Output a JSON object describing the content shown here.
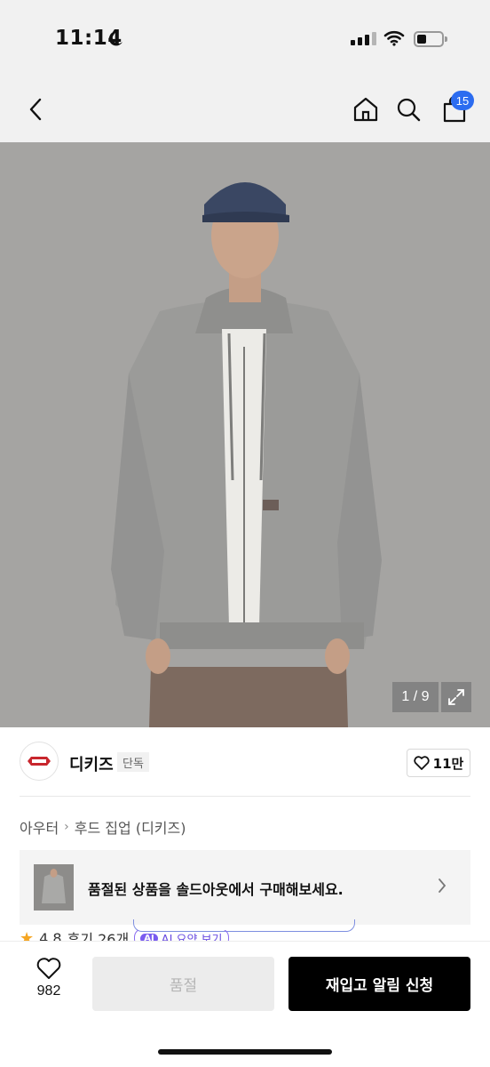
{
  "status_bar": {
    "time": "11:14"
  },
  "nav": {
    "cart_count": "15"
  },
  "product_image": {
    "counter": "1 / 9"
  },
  "brand": {
    "name": "디키즈",
    "badge": "단독",
    "likes": "11만"
  },
  "breadcrumb": {
    "category": "아우터",
    "subcategory": "후드 집업 (디키즈)"
  },
  "soldout_banner": {
    "text": "품절된 상품을 솔드아웃에서 구매해보세요."
  },
  "rating": {
    "score": "4.8",
    "reviews": "후기 26개",
    "ai_tag": "AI",
    "ai_label": "AI 요약 보기"
  },
  "bottom": {
    "wish_count": "982",
    "soldout_label": "품절",
    "restock_label": "재입고 알림 신청"
  },
  "colors": {
    "accent": "#2c6cf0",
    "cta": "#000000",
    "background": "#f1f1f1"
  }
}
